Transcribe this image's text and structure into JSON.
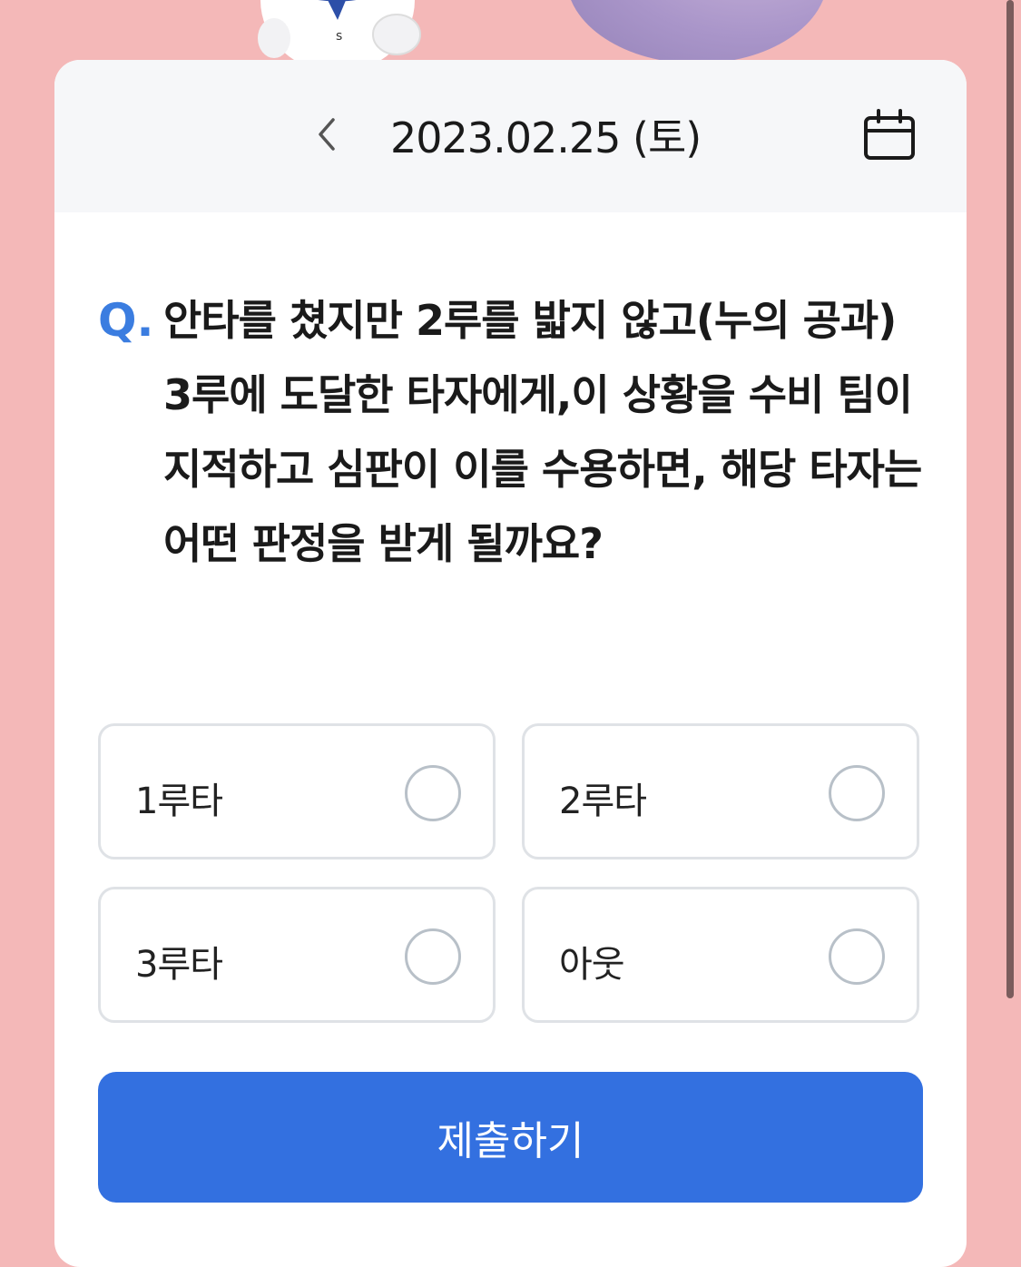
{
  "header": {
    "date": "2023.02.25 (토)",
    "prev_icon": "chevron-left-icon",
    "calendar_icon": "calendar-icon"
  },
  "question": {
    "prefix": "Q.",
    "text": "안타를 쳤지만 2루를 밟지 않고(누의 공과) 3루에 도달한 타자에게,이 상황을 수비 팀이 지적하고 심판이 이를 수용하면, 해당 타자는 어떤 판정을 받게 될까요?"
  },
  "options": [
    {
      "label": "1루타",
      "selected": false
    },
    {
      "label": "2루타",
      "selected": false
    },
    {
      "label": "3루타",
      "selected": false
    },
    {
      "label": "아웃",
      "selected": false
    }
  ],
  "submit_label": "제출하기",
  "colors": {
    "background": "#f4b8b8",
    "accent": "#3370e0",
    "q_mark": "#3b7de0"
  }
}
